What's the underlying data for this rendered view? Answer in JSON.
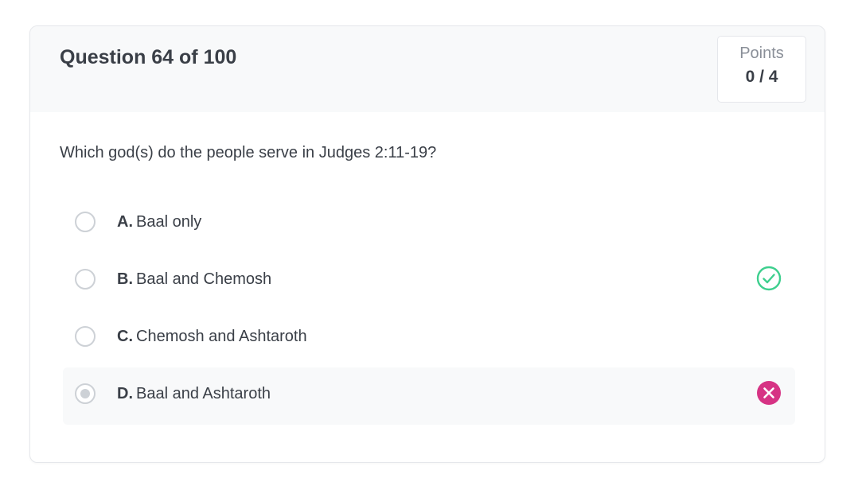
{
  "question": {
    "title": "Question 64 of 100",
    "text": "Which god(s) do the people serve in Judges 2:11-19?"
  },
  "points": {
    "label": "Points",
    "value": "0 / 4"
  },
  "options": [
    {
      "letter": "A.",
      "text": "Baal only",
      "selected": false,
      "status": "none"
    },
    {
      "letter": "B.",
      "text": "Baal and Chemosh",
      "selected": false,
      "status": "correct"
    },
    {
      "letter": "C.",
      "text": "Chemosh and Ashtaroth",
      "selected": false,
      "status": "none"
    },
    {
      "letter": "D.",
      "text": "Baal and Ashtaroth",
      "selected": true,
      "status": "incorrect"
    }
  ],
  "colors": {
    "correct": "#3ecf8e",
    "incorrect": "#d63384",
    "radio_border": "#cdd1d6",
    "header_bg": "#f8f9fa"
  },
  "icons": {
    "correct": "check-circle-icon",
    "incorrect": "x-circle-icon"
  }
}
